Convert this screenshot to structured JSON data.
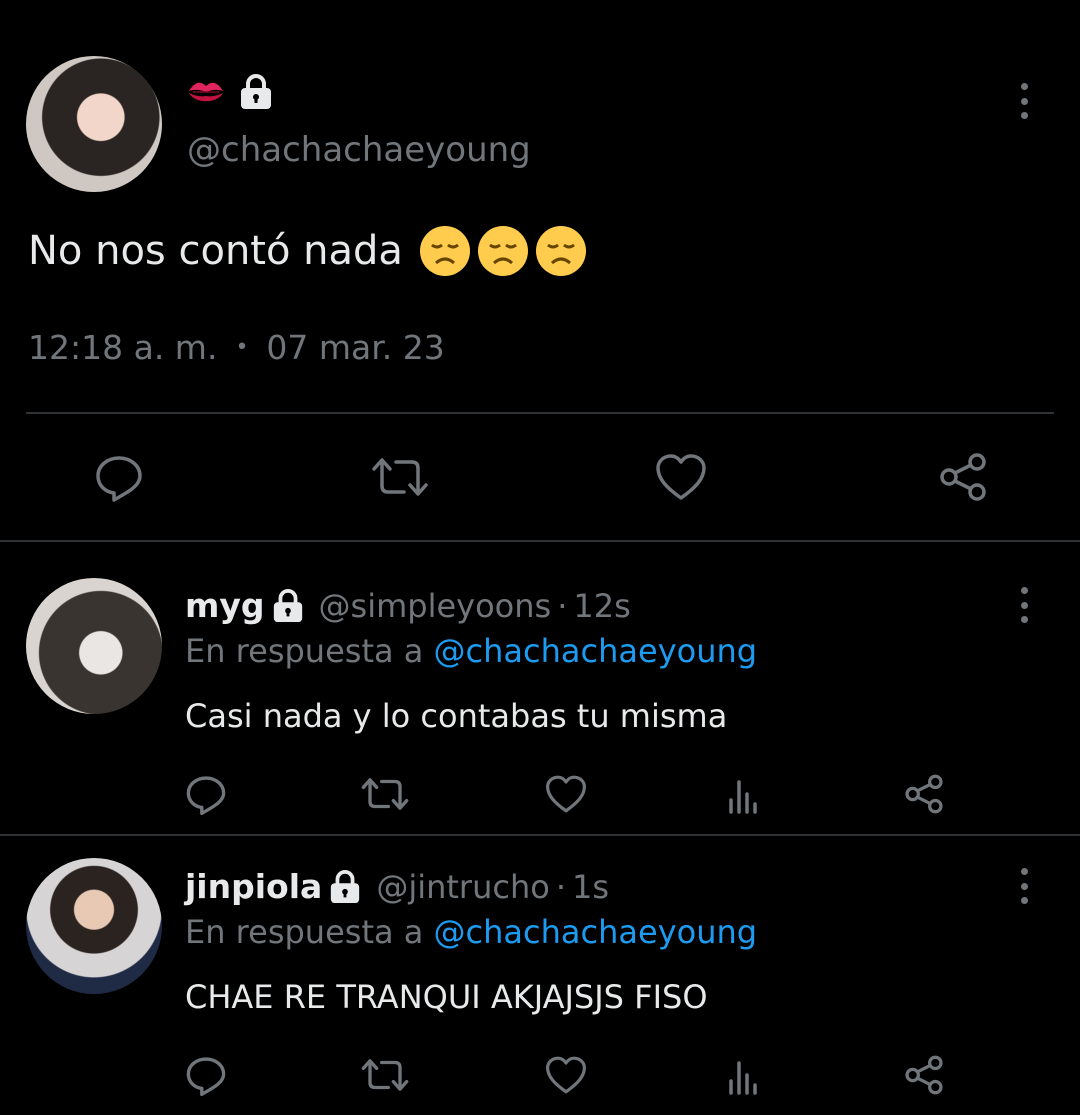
{
  "main_tweet": {
    "handle": "@chachachaeyoung",
    "text": "No nos contó nada",
    "time": "12:18 a. m.",
    "separator": "•",
    "date": "07 mar. 23",
    "icons": {
      "name_emoji": "kiss-mark-icon",
      "protected": "lock-icon",
      "text_emoji": "disappointed-face-icon"
    }
  },
  "replies": [
    {
      "name": "myg",
      "handle": "@simpleyoons",
      "separator": "·",
      "time": "12s",
      "in_reply_prefix": "En respuesta a",
      "in_reply_handle": "@chachachaeyoung",
      "text": "Casi nada y lo contabas tu misma"
    },
    {
      "name": "jinpiola",
      "handle": "@jintrucho",
      "separator": "·",
      "time": "1s",
      "in_reply_prefix": "En respuesta a",
      "in_reply_handle": "@chachachaeyoung",
      "text": "CHAE RE TRANQUI AKJAJSJS FISO"
    }
  ],
  "colors": {
    "background": "#000000",
    "text": "#e7e9ea",
    "muted": "#71767b",
    "link": "#1d9bf0",
    "divider": "#2f3336"
  }
}
